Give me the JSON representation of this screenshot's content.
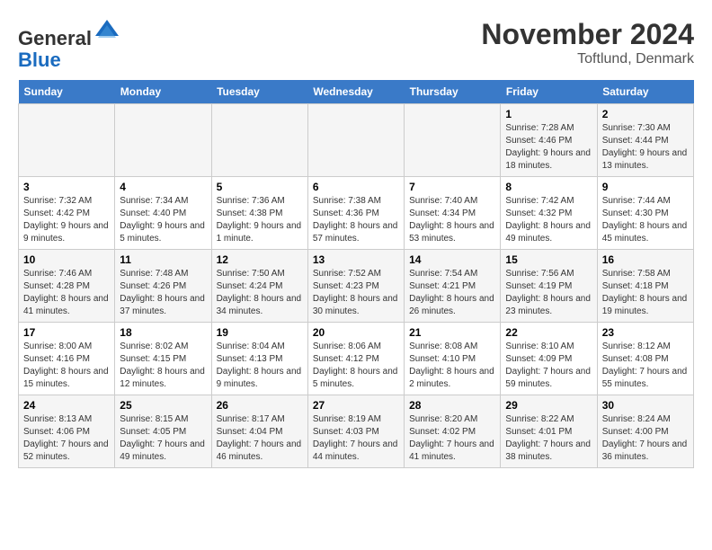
{
  "header": {
    "logo_general": "General",
    "logo_blue": "Blue",
    "month_title": "November 2024",
    "location": "Toftlund, Denmark"
  },
  "weekdays": [
    "Sunday",
    "Monday",
    "Tuesday",
    "Wednesday",
    "Thursday",
    "Friday",
    "Saturday"
  ],
  "weeks": [
    [
      {
        "day": "",
        "info": ""
      },
      {
        "day": "",
        "info": ""
      },
      {
        "day": "",
        "info": ""
      },
      {
        "day": "",
        "info": ""
      },
      {
        "day": "",
        "info": ""
      },
      {
        "day": "1",
        "info": "Sunrise: 7:28 AM\nSunset: 4:46 PM\nDaylight: 9 hours and 18 minutes."
      },
      {
        "day": "2",
        "info": "Sunrise: 7:30 AM\nSunset: 4:44 PM\nDaylight: 9 hours and 13 minutes."
      }
    ],
    [
      {
        "day": "3",
        "info": "Sunrise: 7:32 AM\nSunset: 4:42 PM\nDaylight: 9 hours and 9 minutes."
      },
      {
        "day": "4",
        "info": "Sunrise: 7:34 AM\nSunset: 4:40 PM\nDaylight: 9 hours and 5 minutes."
      },
      {
        "day": "5",
        "info": "Sunrise: 7:36 AM\nSunset: 4:38 PM\nDaylight: 9 hours and 1 minute."
      },
      {
        "day": "6",
        "info": "Sunrise: 7:38 AM\nSunset: 4:36 PM\nDaylight: 8 hours and 57 minutes."
      },
      {
        "day": "7",
        "info": "Sunrise: 7:40 AM\nSunset: 4:34 PM\nDaylight: 8 hours and 53 minutes."
      },
      {
        "day": "8",
        "info": "Sunrise: 7:42 AM\nSunset: 4:32 PM\nDaylight: 8 hours and 49 minutes."
      },
      {
        "day": "9",
        "info": "Sunrise: 7:44 AM\nSunset: 4:30 PM\nDaylight: 8 hours and 45 minutes."
      }
    ],
    [
      {
        "day": "10",
        "info": "Sunrise: 7:46 AM\nSunset: 4:28 PM\nDaylight: 8 hours and 41 minutes."
      },
      {
        "day": "11",
        "info": "Sunrise: 7:48 AM\nSunset: 4:26 PM\nDaylight: 8 hours and 37 minutes."
      },
      {
        "day": "12",
        "info": "Sunrise: 7:50 AM\nSunset: 4:24 PM\nDaylight: 8 hours and 34 minutes."
      },
      {
        "day": "13",
        "info": "Sunrise: 7:52 AM\nSunset: 4:23 PM\nDaylight: 8 hours and 30 minutes."
      },
      {
        "day": "14",
        "info": "Sunrise: 7:54 AM\nSunset: 4:21 PM\nDaylight: 8 hours and 26 minutes."
      },
      {
        "day": "15",
        "info": "Sunrise: 7:56 AM\nSunset: 4:19 PM\nDaylight: 8 hours and 23 minutes."
      },
      {
        "day": "16",
        "info": "Sunrise: 7:58 AM\nSunset: 4:18 PM\nDaylight: 8 hours and 19 minutes."
      }
    ],
    [
      {
        "day": "17",
        "info": "Sunrise: 8:00 AM\nSunset: 4:16 PM\nDaylight: 8 hours and 15 minutes."
      },
      {
        "day": "18",
        "info": "Sunrise: 8:02 AM\nSunset: 4:15 PM\nDaylight: 8 hours and 12 minutes."
      },
      {
        "day": "19",
        "info": "Sunrise: 8:04 AM\nSunset: 4:13 PM\nDaylight: 8 hours and 9 minutes."
      },
      {
        "day": "20",
        "info": "Sunrise: 8:06 AM\nSunset: 4:12 PM\nDaylight: 8 hours and 5 minutes."
      },
      {
        "day": "21",
        "info": "Sunrise: 8:08 AM\nSunset: 4:10 PM\nDaylight: 8 hours and 2 minutes."
      },
      {
        "day": "22",
        "info": "Sunrise: 8:10 AM\nSunset: 4:09 PM\nDaylight: 7 hours and 59 minutes."
      },
      {
        "day": "23",
        "info": "Sunrise: 8:12 AM\nSunset: 4:08 PM\nDaylight: 7 hours and 55 minutes."
      }
    ],
    [
      {
        "day": "24",
        "info": "Sunrise: 8:13 AM\nSunset: 4:06 PM\nDaylight: 7 hours and 52 minutes."
      },
      {
        "day": "25",
        "info": "Sunrise: 8:15 AM\nSunset: 4:05 PM\nDaylight: 7 hours and 49 minutes."
      },
      {
        "day": "26",
        "info": "Sunrise: 8:17 AM\nSunset: 4:04 PM\nDaylight: 7 hours and 46 minutes."
      },
      {
        "day": "27",
        "info": "Sunrise: 8:19 AM\nSunset: 4:03 PM\nDaylight: 7 hours and 44 minutes."
      },
      {
        "day": "28",
        "info": "Sunrise: 8:20 AM\nSunset: 4:02 PM\nDaylight: 7 hours and 41 minutes."
      },
      {
        "day": "29",
        "info": "Sunrise: 8:22 AM\nSunset: 4:01 PM\nDaylight: 7 hours and 38 minutes."
      },
      {
        "day": "30",
        "info": "Sunrise: 8:24 AM\nSunset: 4:00 PM\nDaylight: 7 hours and 36 minutes."
      }
    ]
  ]
}
